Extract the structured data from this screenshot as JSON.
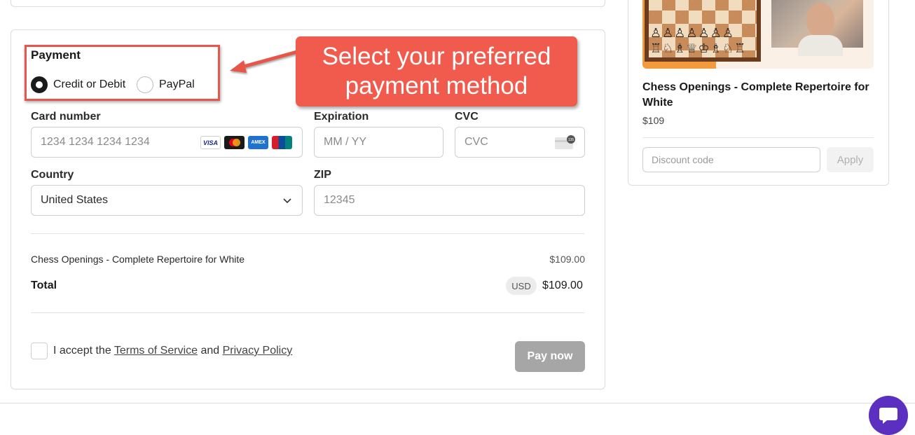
{
  "payment": {
    "title": "Payment",
    "options": [
      {
        "label": "Credit or Debit",
        "selected": true
      },
      {
        "label": "PayPal",
        "selected": false
      }
    ]
  },
  "callout": {
    "line1": "Select your preferred",
    "line2": "payment method",
    "color": "#f05b4d"
  },
  "card": {
    "number_label": "Card number",
    "number_placeholder": "1234 1234 1234 1234",
    "brands": [
      "VISA",
      "Mastercard",
      "AMEX",
      "UnionPay"
    ],
    "expiration_label": "Expiration",
    "expiration_placeholder": "MM / YY",
    "cvc_label": "CVC",
    "cvc_placeholder": "CVC",
    "cvc_icon_text": "135"
  },
  "address": {
    "country_label": "Country",
    "country_value": "United States",
    "zip_label": "ZIP",
    "zip_placeholder": "12345"
  },
  "summary": {
    "item_name": "Chess Openings - Complete Repertoire for White",
    "item_price": "$109.00",
    "total_label": "Total",
    "currency": "USD",
    "total_amount": "$109.00"
  },
  "terms": {
    "prefix": "I accept the",
    "tos_link": "Terms of Service",
    "and": "and",
    "privacy_link": "Privacy Policy"
  },
  "pay_button": "Pay now",
  "product": {
    "title": "Chess Openings - Complete Repertoire for White",
    "price": "$109"
  },
  "discount": {
    "placeholder": "Discount code",
    "apply_label": "Apply"
  },
  "colors": {
    "accent_highlight": "#e8554a",
    "pay_button_disabled": "#a6a6a6",
    "chat_button": "#5b2fbf"
  }
}
